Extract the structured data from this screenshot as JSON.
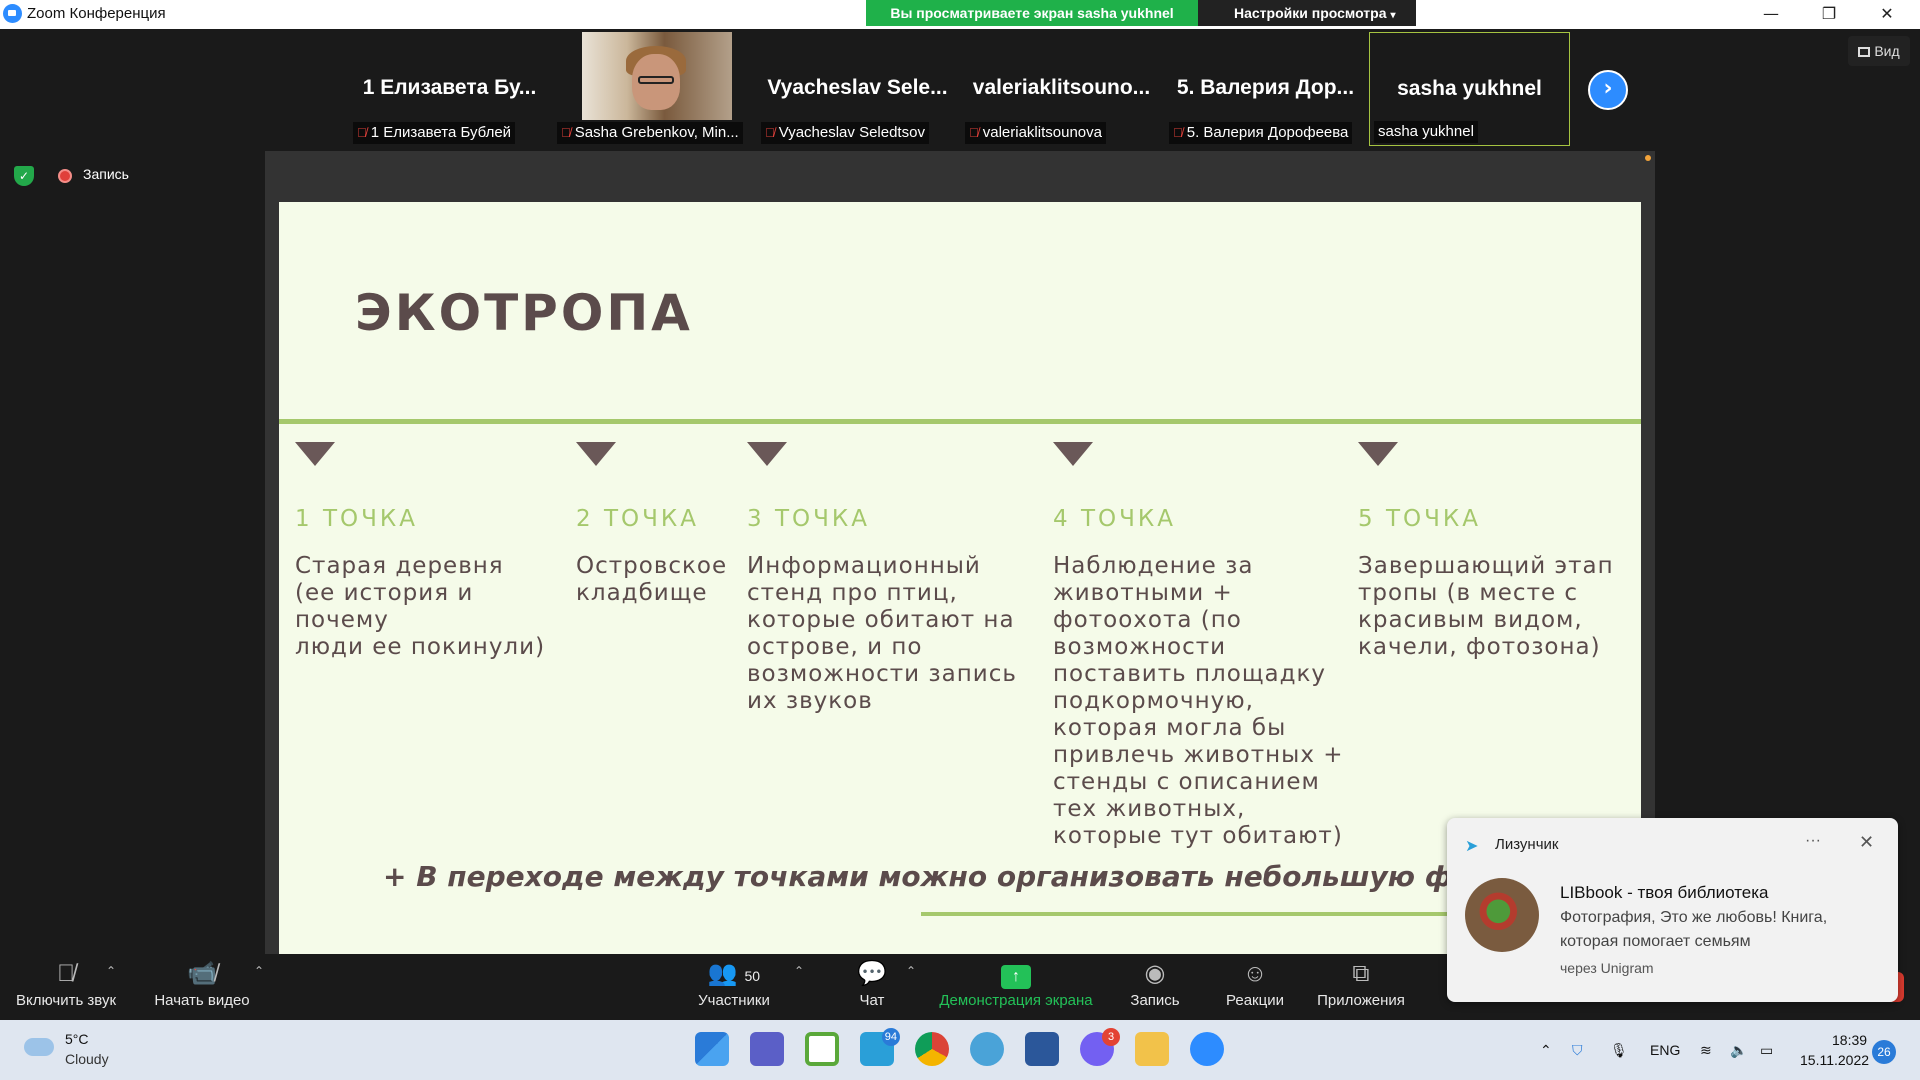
{
  "window": {
    "title": "Zoom Конференция",
    "viewing_banner": "Вы просматриваете экран sasha yukhnel",
    "view_options": "Настройки просмотра",
    "minimize_icon": "minimize-icon",
    "maximize_icon": "restore-icon",
    "close_icon": "close-icon"
  },
  "participants": [
    {
      "big_name": "1 Елизавета Бу...",
      "label": "1 Елизавета Бублей",
      "muted": true,
      "video": false
    },
    {
      "big_name": "",
      "label": "Sasha Grebenkov, Min...",
      "muted": true,
      "video": true
    },
    {
      "big_name": "Vyacheslav Sele...",
      "label": "Vyacheslav Seledtsov",
      "muted": true,
      "video": false
    },
    {
      "big_name": "valeriaklitsouno...",
      "label": "valeriaklitsounova",
      "muted": true,
      "video": false
    },
    {
      "big_name": "5. Валерия Дор...",
      "label": "5. Валерия Дорофеева",
      "muted": true,
      "video": false
    },
    {
      "big_name": "sasha yukhnel",
      "label": "sasha yukhnel",
      "muted": false,
      "video": false
    }
  ],
  "view_button": "Вид",
  "recording_label": "Запись",
  "slide": {
    "title": "ЭКОТРОПА",
    "points": [
      {
        "label": "1 ТОЧКА",
        "text": "Старая деревня\n(ее история и почему\nлюди ее покинули)"
      },
      {
        "label": "2 ТОЧКА",
        "text": "Островское\nкладбище"
      },
      {
        "label": "3 ТОЧКА",
        "text": "Информационный\nстенд про птиц,\nкоторые обитают на\nострове, и по\nвозможности запись\nих звуков"
      },
      {
        "label": "4 ТОЧКА",
        "text": "Наблюдение за\nживотными +\nфотоохота (по\nвозможности\nпоставить площадку\nподкормочную,\nкоторая могла бы\nпривлечь животных +\nстенды с описанием\nтех животных,\nкоторые тут обитают)"
      },
      {
        "label": "5 ТОЧКА",
        "text": "Завершающий этап\nтропы (в месте с\nкрасивым видом,\nкачели, фотозона)"
      }
    ],
    "note": "+ В переходе между точками  можно организовать небольшую фот"
  },
  "toolbar": {
    "unmute": "Включить звук",
    "start_video": "Начать видео",
    "participants": "Участники",
    "participants_count": "50",
    "chat": "Чат",
    "share": "Демонстрация экрана",
    "record": "Запись",
    "reactions": "Реакции",
    "apps": "Приложения"
  },
  "notification": {
    "sender": "Лизунчик",
    "title": "LIBbook - твоя библиотека",
    "body": "Фотография, Это же любовь! Книга, которая помогает семьям",
    "via": "через Unigram"
  },
  "taskbar": {
    "weather_temp": "5°C",
    "weather_cond": "Cloudy",
    "telegram_badge": "94",
    "viber_badge": "3",
    "lang": "ENG",
    "time": "18:39",
    "date": "15.11.2022",
    "notif_count": "26"
  },
  "colors": {
    "accent_green": "#a5c86c",
    "slide_text": "#5b4b4b",
    "slide_bg": "#f5fbe9",
    "zoom_blue": "#2d8cff",
    "share_green": "#23c158"
  }
}
